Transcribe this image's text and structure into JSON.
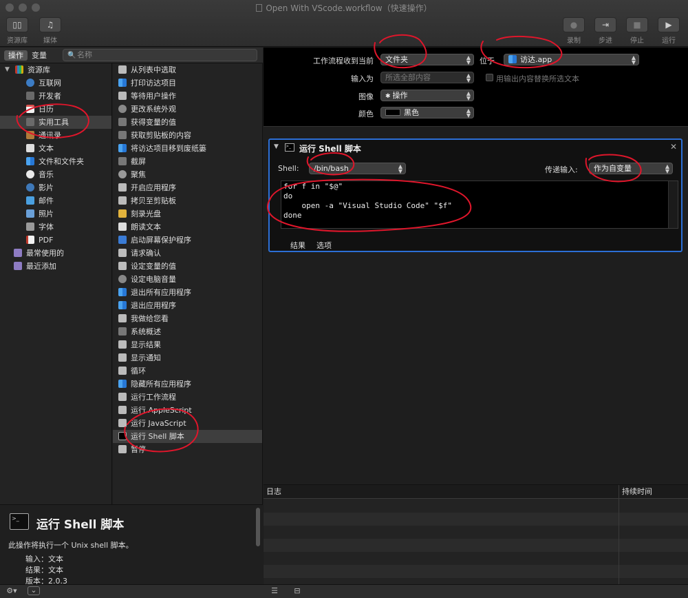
{
  "window": {
    "title": "Open With VScode.workflow（快速操作）"
  },
  "toolbar": {
    "library_label": "资源库",
    "media_label": "媒体",
    "record_label": "录制",
    "step_label": "步进",
    "stop_label": "停止",
    "run_label": "运行"
  },
  "library": {
    "tab_actions": "操作",
    "tab_variables": "变量",
    "search_placeholder": "名称",
    "categories": [
      {
        "label": "资源库",
        "color": "#9a7b3a"
      },
      {
        "label": "互联网",
        "color": "#3c7cc4"
      },
      {
        "label": "开发者",
        "color": "#8a8a8a"
      },
      {
        "label": "日历",
        "color": "#d9534f"
      },
      {
        "label": "实用工具",
        "color": "#8a8a8a"
      },
      {
        "label": "通讯录",
        "color": "#b07a3a"
      },
      {
        "label": "文本",
        "color": "#dddddd"
      },
      {
        "label": "文件和文件夹",
        "color": "#3a8ee6"
      },
      {
        "label": "音乐",
        "color": "#e9e9e9"
      },
      {
        "label": "影片",
        "color": "#3e78b8"
      },
      {
        "label": "邮件",
        "color": "#4aa0e0"
      },
      {
        "label": "照片",
        "color": "#6aa0d8"
      },
      {
        "label": "字体",
        "color": "#9a9a9a"
      },
      {
        "label": "PDF",
        "color": "#c0392b"
      },
      {
        "label": "最常使用的",
        "color": "#8e7cc3"
      },
      {
        "label": "最近添加",
        "color": "#8e7cc3"
      }
    ],
    "actions": [
      "从列表中选取",
      "打印访达项目",
      "等待用户操作",
      "更改系统外观",
      "获得变量的值",
      "获取剪贴板的内容",
      "将访达项目移到废纸篓",
      "截屏",
      "聚焦",
      "开启应用程序",
      "拷贝至剪贴板",
      "刻录光盘",
      "朗读文本",
      "启动屏幕保护程序",
      "请求确认",
      "设定变量的值",
      "设定电脑音量",
      "退出所有应用程序",
      "退出应用程序",
      "我做给您看",
      "系统概述",
      "显示结果",
      "显示通知",
      "循环",
      "隐藏所有应用程序",
      "运行工作流程",
      "运行 AppleScript",
      "运行 JavaScript",
      "运行 Shell 脚本",
      "暂停"
    ]
  },
  "description": {
    "title": "运行 Shell 脚本",
    "text": "此操作将执行一个 Unix shell 脚本。",
    "input_label": "输入：",
    "input_value": "文本",
    "result_label": "结果：",
    "result_value": "文本",
    "version_label": "版本：",
    "version_value": "2.0.3"
  },
  "workflow": {
    "receives_label": "工作流程收到当前",
    "receives_value": "文件夹",
    "in_label": "位于",
    "in_value": "访达.app",
    "input_is_label": "输入为",
    "input_is_value": "所选全部内容",
    "replace_text_label": "用输出内容替换所选文本",
    "image_label": "图像",
    "image_value": "操作",
    "color_label": "颜色",
    "color_value": "黑色"
  },
  "action": {
    "title": "运行 Shell 脚本",
    "shell_label": "Shell:",
    "shell_value": "/bin/bash",
    "pass_input_label": "传递输入:",
    "pass_input_value": "作为自变量",
    "script_line1": "for f in \"$@\"",
    "script_line2": "do",
    "script_line3": "    open -a \"Visual Studio Code\" \"$f\"",
    "script_line4": "done",
    "tab_results": "结果",
    "tab_options": "选项"
  },
  "log": {
    "col_log": "日志",
    "col_duration": "持续时间"
  },
  "colors": {
    "accent": "#2c6fd6",
    "annotation": "#e0162b"
  }
}
